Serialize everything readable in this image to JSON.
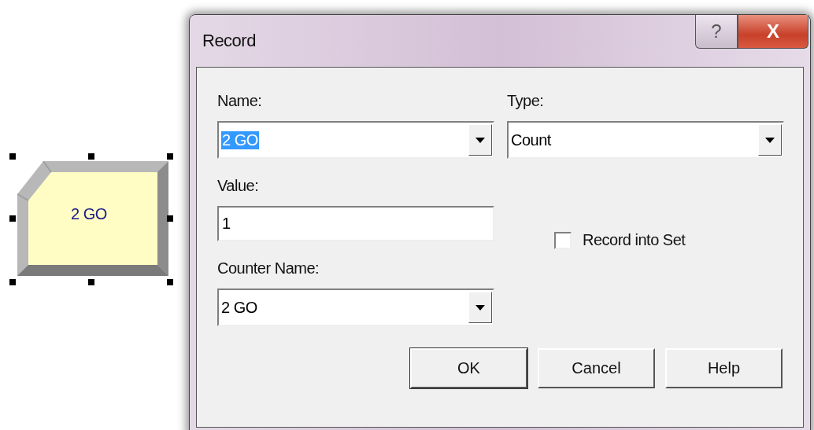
{
  "canvas": {
    "module": {
      "label": "2 GO",
      "selected": true
    }
  },
  "window": {
    "title": "Record",
    "help_button": "?",
    "close_button": "X"
  },
  "form": {
    "name": {
      "label": "Name:",
      "value": "2 GO",
      "text_selected": true
    },
    "type": {
      "label": "Type:",
      "value": "Count"
    },
    "value": {
      "label": "Value:",
      "value": "1"
    },
    "record_into_set": {
      "label": "Record into Set",
      "checked": false
    },
    "counter_name": {
      "label": "Counter Name:",
      "value": "2 GO"
    }
  },
  "buttons": [
    {
      "label": "OK",
      "default": true
    },
    {
      "label": "Cancel",
      "default": false
    },
    {
      "label": "Help",
      "default": false
    }
  ]
}
